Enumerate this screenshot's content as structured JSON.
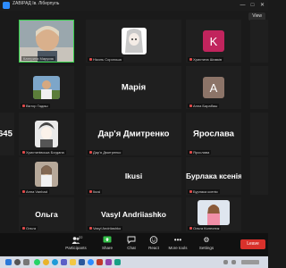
{
  "window": {
    "title": "ZABIPAД Ів. Ліберпуль",
    "controls": [
      "—",
      "□",
      "✕"
    ]
  },
  "view_button": "View",
  "tiles": [
    {
      "id": "t1",
      "name": "Катерина Марусяк",
      "big": "",
      "avatar": "photo-kateryna",
      "active": true
    },
    {
      "id": "t2",
      "name": "Ніколь Сорогоша",
      "big": "",
      "avatar": "anime-girl"
    },
    {
      "id": "t3",
      "name": "Христина Шимків",
      "big": "",
      "avatar": "letter-k",
      "letter": "K",
      "letter_color": "#c1245d"
    },
    {
      "id": "t4",
      "name": "Віктор Гадиш",
      "big": "",
      "avatar": "photo-viktor"
    },
    {
      "id": "t5",
      "name": "",
      "big": "Марія",
      "avatar": ""
    },
    {
      "id": "t6",
      "name": "Анна Барабаш",
      "big": "",
      "avatar": "letter-a",
      "letter": "A",
      "letter_color": "#8c7468"
    },
    {
      "id": "t7",
      "name": "",
      "big": "645",
      "avatar": ""
    },
    {
      "id": "t8",
      "name": "Христинівська Богдана",
      "big": "",
      "avatar": "anime-boy"
    },
    {
      "id": "t9",
      "name": "Дар'я Дмитренко",
      "big": "Дар'я Дмитренко",
      "avatar": ""
    },
    {
      "id": "t10",
      "name": "Ярослава",
      "big": "Ярослава",
      "avatar": ""
    },
    {
      "id": "t11",
      "name": "Анна Vanbad",
      "big": "",
      "avatar": "photo-anna"
    },
    {
      "id": "t12",
      "name": "Ikusi",
      "big": "Ikusi",
      "avatar": ""
    },
    {
      "id": "t13",
      "name": "Бурлака ксенія",
      "big": "Бурлака ксенія",
      "avatar": ""
    },
    {
      "id": "t14",
      "name": "Ольга",
      "big": "Ольга",
      "avatar": ""
    },
    {
      "id": "t15",
      "name": "Vasyl Andriiashko",
      "big": "Vasyl Andriiashko",
      "avatar": ""
    },
    {
      "id": "t16",
      "name": "Ольга Колесник",
      "big": "",
      "avatar": "photo-olga"
    }
  ],
  "toolbar": {
    "participants_label": "Participants",
    "participants_count": "22",
    "share_label": "Share",
    "chat_label": "Chat",
    "react_label": "React",
    "more_label": "More tools",
    "settings_label": "Settings",
    "end_label": "Leave"
  },
  "colors": {
    "active_border": "#35d14a",
    "leave_button": "#d9312b",
    "background": "#1a1a1a"
  }
}
